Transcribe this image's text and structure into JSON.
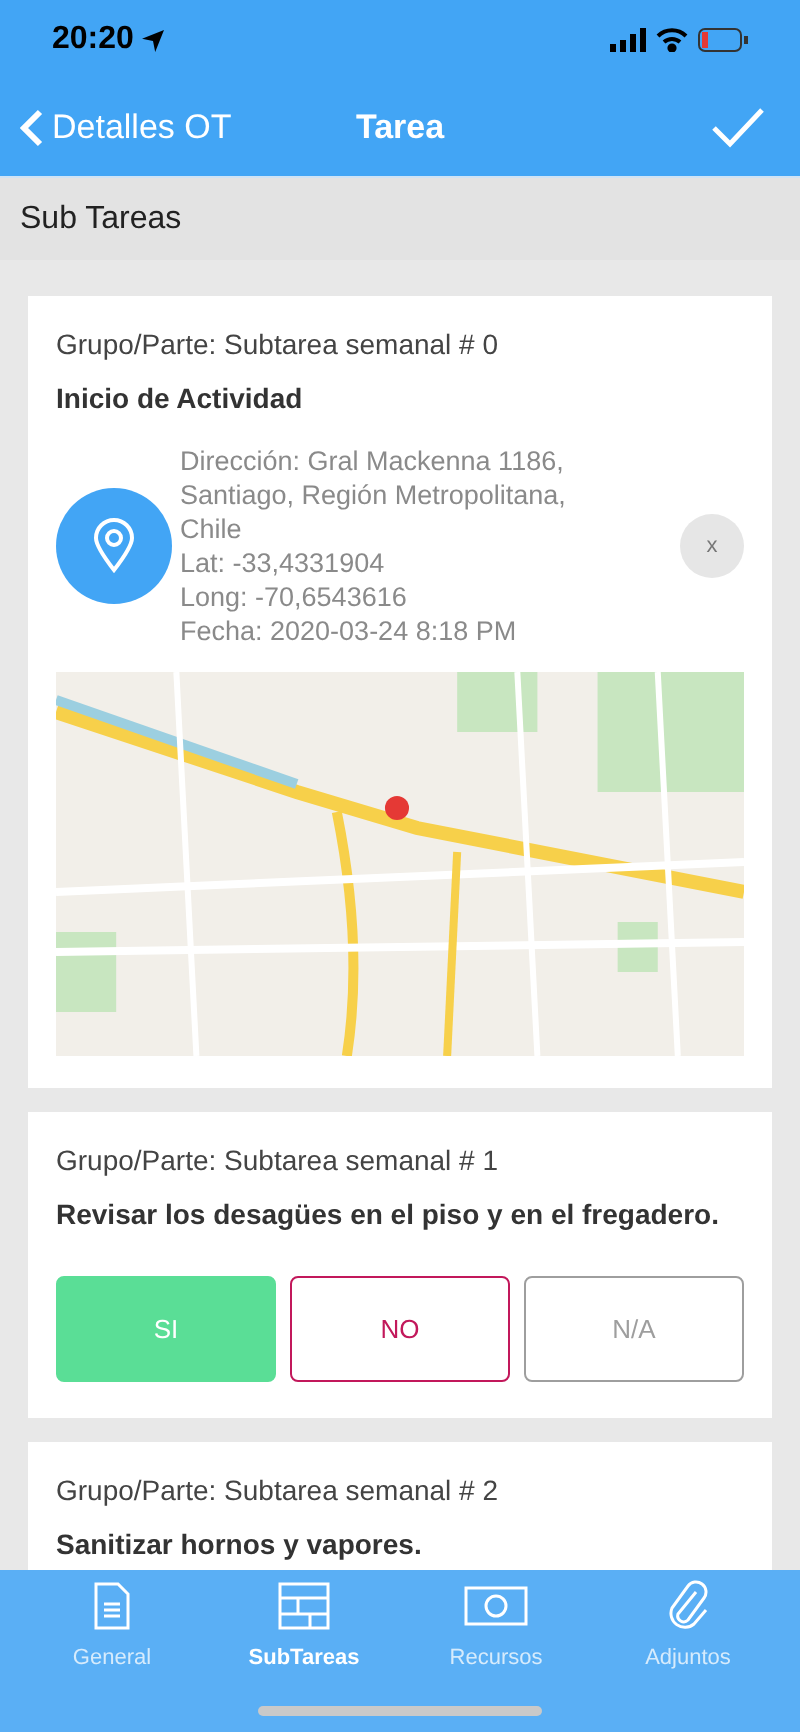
{
  "status_bar": {
    "time": "20:20"
  },
  "nav": {
    "back": "Detalles OT",
    "title": "Tarea"
  },
  "section": {
    "title": "Sub Tareas"
  },
  "cards": [
    {
      "kind": "location",
      "group": "Grupo/Parte: Subtarea semanal # 0",
      "title": "Inicio de Actividad",
      "lines": [
        "Dirección: Gral Mackenna 1186, Santiago, Región Metropolitana, Chile",
        "Lat: -33,4331904",
        "Long: -70,6543616",
        "Fecha: 2020-03-24 8:18 PM"
      ],
      "remove": "x"
    },
    {
      "kind": "choice",
      "group": "Grupo/Parte: Subtarea semanal # 1",
      "title": "Revisar los desagües en el piso y en el fregadero.",
      "options": [
        {
          "label": "SI",
          "selected": true,
          "color": "#5ade96"
        },
        {
          "label": "NO",
          "selected": false,
          "color": "#c2185b"
        },
        {
          "label": "N/A",
          "selected": false,
          "color": "#9e9e9e"
        }
      ]
    },
    {
      "kind": "text",
      "group": "Grupo/Parte: Subtarea semanal # 2",
      "title": "Sanitizar hornos y vapores."
    }
  ],
  "tabs": [
    {
      "label": "General",
      "selected": false
    },
    {
      "label": "SubTareas",
      "selected": true
    },
    {
      "label": "Recursos",
      "selected": false
    },
    {
      "label": "Adjuntos",
      "selected": false
    }
  ]
}
